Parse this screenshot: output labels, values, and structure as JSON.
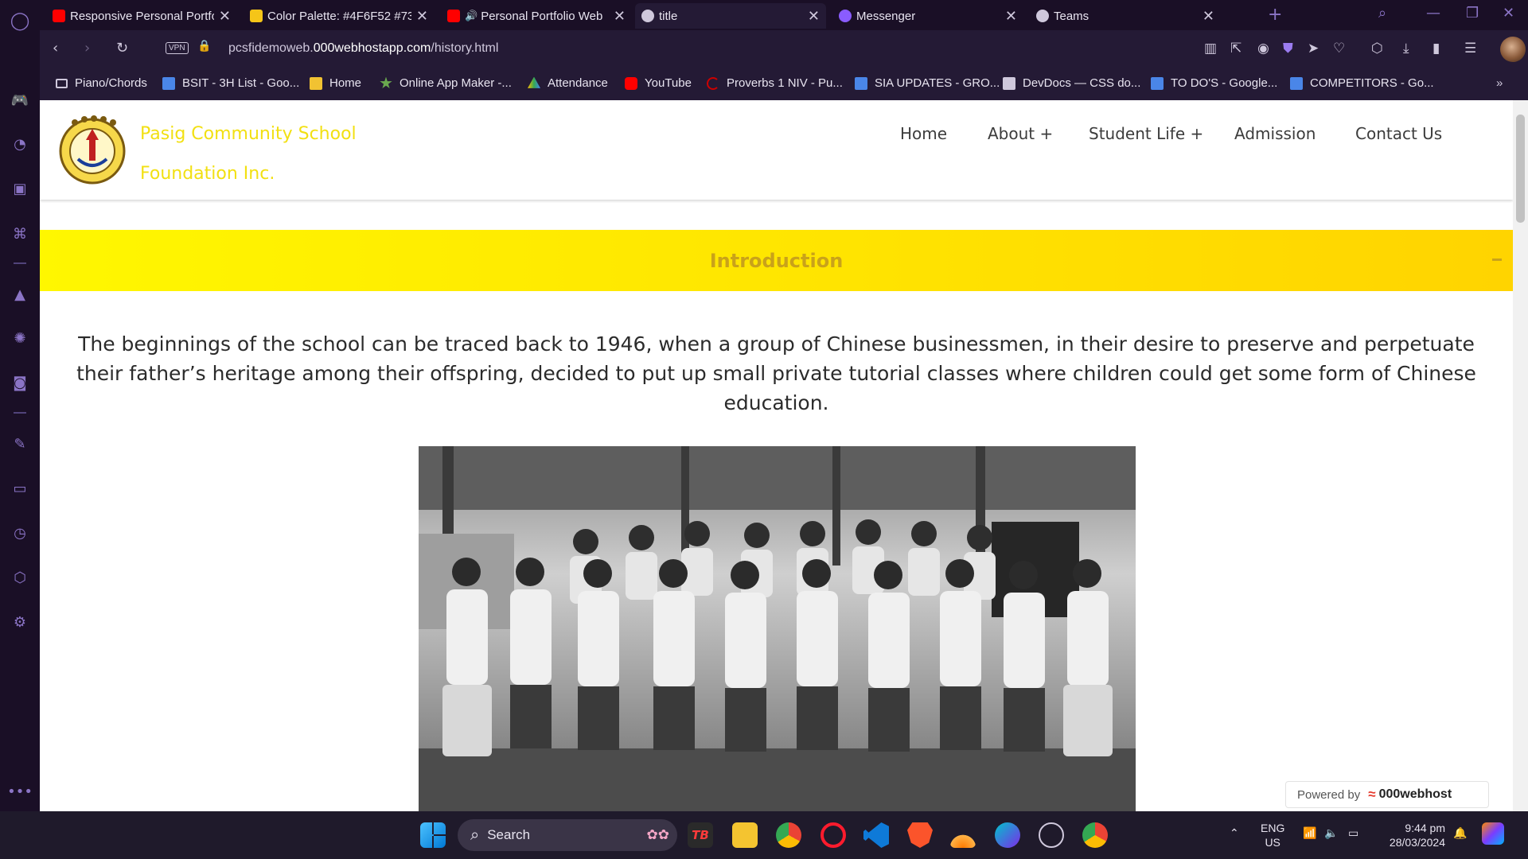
{
  "browser": {
    "tabs": [
      {
        "title": "Responsive Personal Portfo",
        "favicon_color": "#ff0000",
        "active": false
      },
      {
        "title": "Color Palette: #4F6F52 #73",
        "favicon_color": "#f5c518",
        "active": false
      },
      {
        "title": "Personal Portfolio Web",
        "favicon_color": "#ff0000",
        "active": false
      },
      {
        "title": "title",
        "favicon_color": "#cfc8dc",
        "active": true
      },
      {
        "title": "Messenger",
        "favicon_color": "#8a5cff",
        "active": false
      },
      {
        "title": "Teams",
        "favicon_color": "#cfc8dc",
        "active": false
      }
    ],
    "vpn_label": "VPN",
    "url_prefix": "pcsfidemoweb.",
    "url_domain": "000webhostapp.com",
    "url_path": "/history.html",
    "bookmarks": [
      {
        "label": "Piano/Chords",
        "icon_color": "#cfc8dc"
      },
      {
        "label": "BSIT - 3H List - Goo...",
        "icon_color": "#4a86e8"
      },
      {
        "label": "Home",
        "icon_color": "#f1c232"
      },
      {
        "label": "Online App Maker -...",
        "icon_color": "#6aa84f"
      },
      {
        "label": "Attendance",
        "icon_color": "#34a853"
      },
      {
        "label": "YouTube",
        "icon_color": "#ff0000"
      },
      {
        "label": "Proverbs 1 NIV - Pu...",
        "icon_color": "#cc0000"
      },
      {
        "label": "SIA UPDATES - GRO...",
        "icon_color": "#4a86e8"
      },
      {
        "label": "DevDocs — CSS do...",
        "icon_color": "#cfc8dc"
      },
      {
        "label": "TO DO'S - Google...",
        "icon_color": "#4a86e8"
      },
      {
        "label": "COMPETITORS - Go...",
        "icon_color": "#4a86e8"
      }
    ]
  },
  "site": {
    "brand_line1": "Pasig Community School",
    "brand_line2": "Foundation Inc.",
    "nav": [
      "Home",
      "About +",
      "Student Life +",
      "Admission",
      "Contact Us"
    ],
    "intro_title": "Introduction",
    "intro_text": "The beginnings of the school can be traced back to 1946, when a group of Chinese businessmen, in their desire to preserve and perpetuate their father’s heritage among their offspring, decided to put up small private tutorial classes where children could get some form of Chinese education.",
    "powered_label": "Powered by",
    "powered_brand": "000webhost"
  },
  "taskbar": {
    "search_label": "Search",
    "lang_line1": "ENG",
    "lang_line2": "US",
    "time": "9:44 pm",
    "date": "28/03/2024"
  },
  "colors": {
    "accent": "#8b74c6",
    "brand_yellow": "#f2e012",
    "intro_gold": "#c9a21a"
  }
}
